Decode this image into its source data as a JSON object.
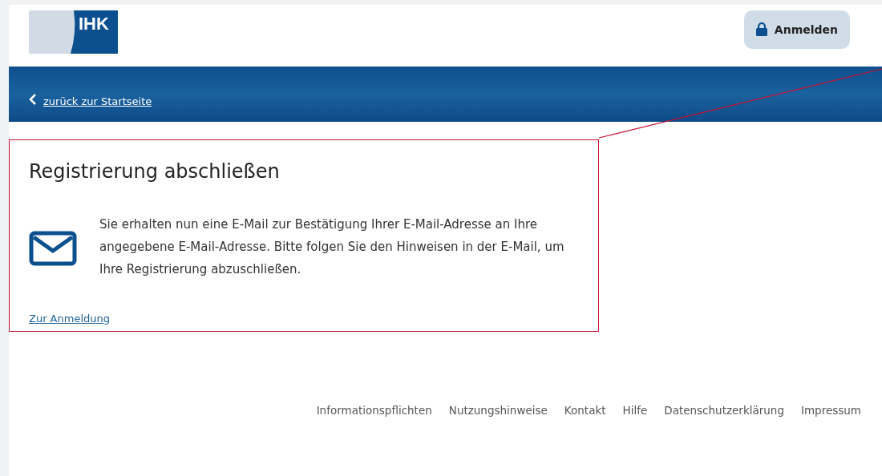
{
  "header": {
    "logo_text": "IHK",
    "login_button": "Anmelden"
  },
  "banner": {
    "back_link": "zurück zur Startseite"
  },
  "content": {
    "highlighted": true,
    "title": "Registrierung abschließen",
    "message": "Sie erhalten nun eine E-Mail zur Bestätigung Ihrer E-Mail-Adresse an Ihre angegebene E-Mail-Adresse. Bitte folgen Sie den Hinweisen in der E-Mail, um Ihre Registrierung abzuschließen.",
    "link": "Zur Anmeldung"
  },
  "footer": {
    "links": [
      "Informationspflichten",
      "Nutzungshinweise",
      "Kontakt",
      "Hilfe",
      "Datenschutzerklärung",
      "Impressum"
    ]
  }
}
